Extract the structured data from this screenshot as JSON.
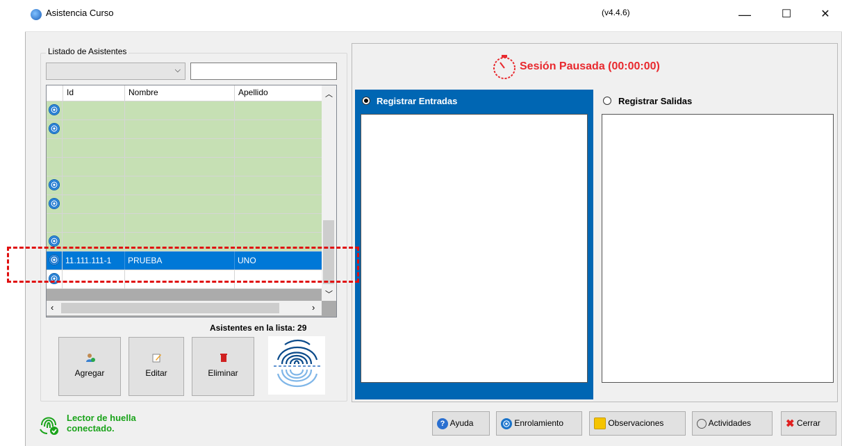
{
  "window": {
    "title": "Asistencia Curso",
    "version": "(v4.4.6)",
    "controls": {
      "minimize": "—",
      "maximize": "☐",
      "close": "✕"
    }
  },
  "left_panel": {
    "group_label": "Listado de Asistentes",
    "filter_combo_value": "",
    "search_value": "",
    "grid": {
      "columns": [
        "Id",
        "Nombre",
        "Apellido"
      ],
      "rows": [
        {
          "id": "",
          "nombre": "",
          "apellido": "",
          "fingerprint": true,
          "selected": false
        },
        {
          "id": "",
          "nombre": "",
          "apellido": "",
          "fingerprint": true,
          "selected": false
        },
        {
          "id": "",
          "nombre": "",
          "apellido": "",
          "fingerprint": false,
          "selected": false
        },
        {
          "id": "",
          "nombre": "",
          "apellido": "",
          "fingerprint": false,
          "selected": false
        },
        {
          "id": "",
          "nombre": "",
          "apellido": "",
          "fingerprint": true,
          "selected": false
        },
        {
          "id": "",
          "nombre": "",
          "apellido": "",
          "fingerprint": true,
          "selected": false
        },
        {
          "id": "",
          "nombre": "",
          "apellido": "",
          "fingerprint": false,
          "selected": false
        },
        {
          "id": "",
          "nombre": "",
          "apellido": "",
          "fingerprint": true,
          "selected": false
        },
        {
          "id": "11.111.111-1",
          "nombre": "PRUEBA",
          "apellido": "UNO",
          "fingerprint": true,
          "selected": true
        },
        {
          "id": "",
          "nombre": "",
          "apellido": "",
          "fingerprint": true,
          "selected": false
        }
      ]
    },
    "count_label": "Asistentes en la lista: 29",
    "buttons": {
      "add": "Agregar",
      "edit": "Editar",
      "delete": "Eliminar"
    }
  },
  "right_panel": {
    "session_status": "Sesión Pausada (00:00:00)",
    "status_color": "#e8292e",
    "entries_label": "Registrar Entradas",
    "exits_label": "Registrar Salidas",
    "entries_selected": true
  },
  "footer": {
    "reader_status_line1": "Lector de huella",
    "reader_status_line2": "conectado.",
    "reader_status_color": "#1aa31a",
    "buttons": {
      "help": "Ayuda",
      "enroll": "Enrolamiento",
      "observations": "Observaciones",
      "activities": "Actividades",
      "close": "Cerrar"
    }
  }
}
